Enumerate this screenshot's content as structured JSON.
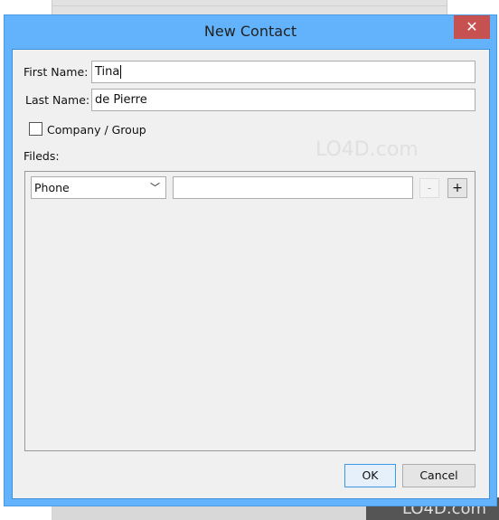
{
  "window": {
    "title": "New Contact",
    "close_icon": "close-icon"
  },
  "form": {
    "first_name_label": "First Name:",
    "first_name_value": "Tina",
    "last_name_label": "Last Name:",
    "last_name_value": "de Pierre",
    "company_checkbox_label": "Company / Group",
    "company_checked": false,
    "fields_label": "Fileds:",
    "field_type": "Phone",
    "field_value": "",
    "remove_label": "-",
    "add_label": "+"
  },
  "buttons": {
    "ok": "OK",
    "cancel": "Cancel"
  },
  "watermark": "LO4D.com",
  "colors": {
    "titlebar": "#62b3fb",
    "close": "#c75050"
  }
}
